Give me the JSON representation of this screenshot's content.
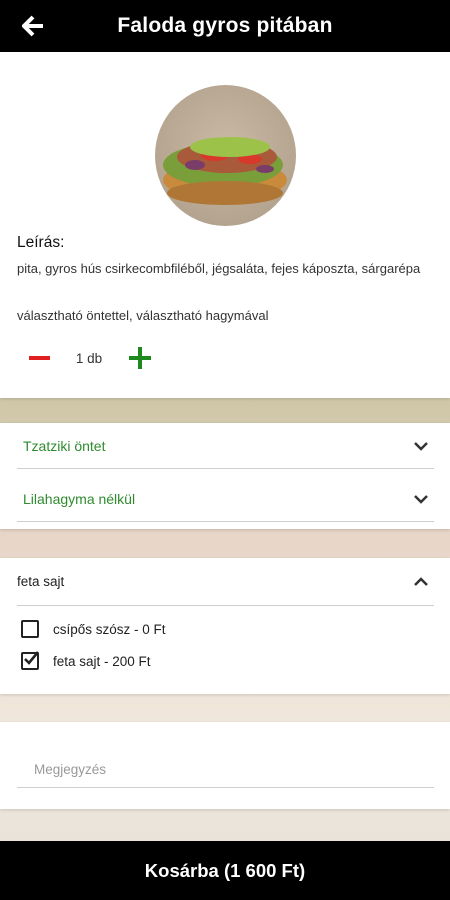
{
  "header": {
    "title": "Faloda gyros pitában",
    "back_icon": "arrow-left-icon"
  },
  "product": {
    "description_label": "Leírás:",
    "description": "pita, gyros hús csirkecombfiléből, jégsaláta, fejes káposzta, sárgarépa",
    "options_note": "választható öntettel, választható hagymával"
  },
  "quantity": {
    "value": "1 db",
    "decrease_icon": "minus-icon",
    "increase_icon": "plus-icon"
  },
  "selects": [
    {
      "label": "Tzatziki öntet"
    },
    {
      "label": "Lilahagyma nélkül"
    }
  ],
  "extras": {
    "header": "feta sajt",
    "items": [
      {
        "label": "csípős szósz - 0 Ft",
        "checked": false
      },
      {
        "label": "feta sajt - 200 Ft",
        "checked": true
      }
    ]
  },
  "note": {
    "placeholder": "Megjegyzés"
  },
  "cart": {
    "button_label": "Kosárba (1 600 Ft)"
  },
  "colors": {
    "topbar": "#000000",
    "accent_green": "#1e8a1e",
    "remove_red": "#e02020"
  }
}
